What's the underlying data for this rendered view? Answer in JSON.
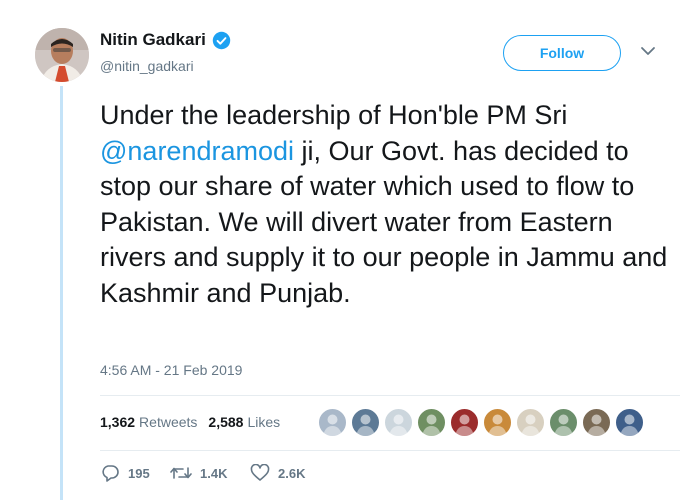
{
  "user": {
    "display_name": "Nitin Gadkari",
    "handle": "@nitin_gadkari",
    "verified_icon": "verified-badge-icon",
    "avatar_icon": "profile-photo"
  },
  "follow": {
    "label": "Follow"
  },
  "menu": {
    "icon": "chevron-down-icon"
  },
  "tweet": {
    "text_before": "Under the leadership of Hon'ble PM Sri\n",
    "mention": "@narendramodi",
    "text_after": " ji, Our Govt. has decided to stop our share of water which used to flow to Pakistan. We will divert water from Eastern rivers and supply it to our people in Jammu and Kashmir and Punjab."
  },
  "timestamp": "4:56 AM - 21 Feb 2019",
  "stats": {
    "retweets_count": "1,362",
    "retweets_label": "Retweets",
    "likes_count": "2,588",
    "likes_label": "Likes"
  },
  "likers": [
    {
      "color": "#a9b8c9"
    },
    {
      "color": "#5d7a96"
    },
    {
      "color": "#ccd6dd"
    },
    {
      "color": "#6f8f62"
    },
    {
      "color": "#9b2c2c"
    },
    {
      "color": "#c98a3a"
    },
    {
      "color": "#d8d0c0"
    },
    {
      "color": "#6b8e6b"
    },
    {
      "color": "#7a6a55"
    },
    {
      "color": "#3f5f8a"
    }
  ],
  "actions": {
    "reply_count": "195",
    "retweet_count": "1.4K",
    "like_count": "2.6K"
  },
  "colors": {
    "accent": "#1da1f2",
    "mention": "#1b95e0",
    "secondary_text": "#657786",
    "thread_line": "#c4e3f8"
  }
}
